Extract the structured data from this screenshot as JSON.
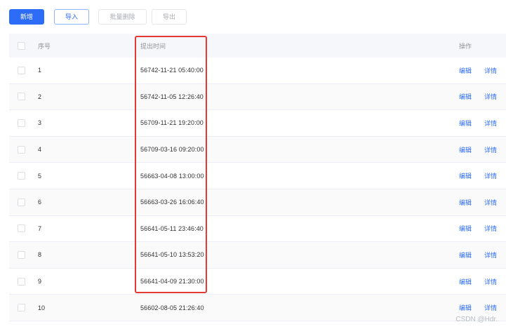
{
  "toolbar": {
    "add_label": "新增",
    "import_label": "导入",
    "batch_delete_label": "批量删除",
    "export_label": "导出"
  },
  "table": {
    "columns": {
      "index": "序号",
      "submit_time": "提出时间",
      "actions": "操作"
    },
    "rows": [
      {
        "index": "1",
        "time": "56742-11-21 05:40:00",
        "edit": "编辑",
        "detail": "详情"
      },
      {
        "index": "2",
        "time": "56742-11-05 12:26:40",
        "edit": "编辑",
        "detail": "详情"
      },
      {
        "index": "3",
        "time": "56709-11-21 19:20:00",
        "edit": "编辑",
        "detail": "详情"
      },
      {
        "index": "4",
        "time": "56709-03-16 09:20:00",
        "edit": "编辑",
        "detail": "详情"
      },
      {
        "index": "5",
        "time": "56663-04-08 13:00:00",
        "edit": "编辑",
        "detail": "详情"
      },
      {
        "index": "6",
        "time": "56663-03-26 16:06:40",
        "edit": "编辑",
        "detail": "详情"
      },
      {
        "index": "7",
        "time": "56641-05-11 23:46:40",
        "edit": "编辑",
        "detail": "详情"
      },
      {
        "index": "8",
        "time": "56641-05-10 13:53:20",
        "edit": "编辑",
        "detail": "详情"
      },
      {
        "index": "9",
        "time": "56641-04-09 21:30:00",
        "edit": "编辑",
        "detail": "详情"
      },
      {
        "index": "10",
        "time": "56602-08-05 21:26:40",
        "edit": "编辑",
        "detail": "详情"
      }
    ]
  },
  "watermark": "CSDN @Hdr.",
  "colors": {
    "primary": "#2d6cf6",
    "highlight_border": "#e53935",
    "header_bg": "#f5f7fa"
  }
}
